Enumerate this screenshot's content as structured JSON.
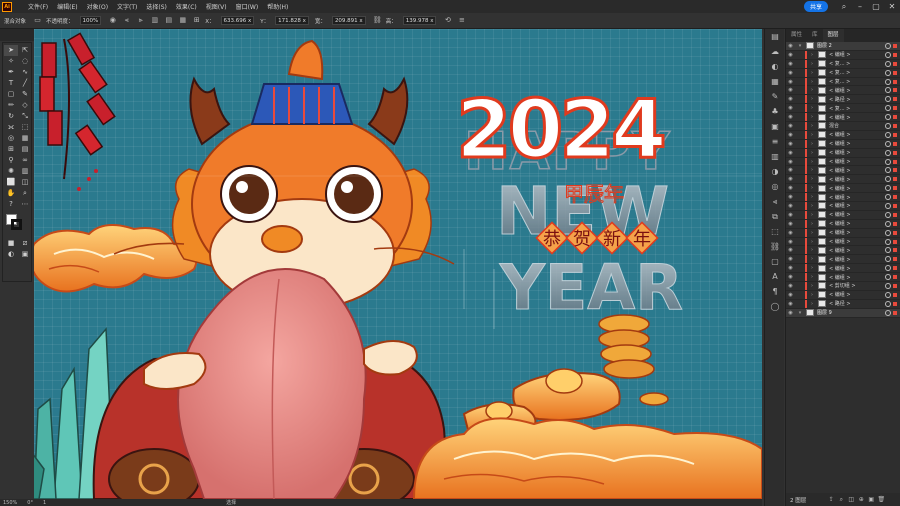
{
  "menu": {
    "logo": "Ai",
    "items": [
      "文件(F)",
      "编辑(E)",
      "对象(O)",
      "文字(T)",
      "选择(S)",
      "效果(C)",
      "视图(V)",
      "窗口(W)",
      "帮助(H)"
    ],
    "share_label": "共享"
  },
  "control": {
    "selection_label": "混合对象",
    "opacity_label": "不透明度：",
    "opacity_value": "100%",
    "x_label": "X：",
    "x_value": "633.696 x",
    "y_label": "Y：",
    "y_value": "171.828 x",
    "w_label": "宽：",
    "w_value": "209.891 x",
    "h_label": "高：",
    "h_value": "139.978 x"
  },
  "status": {
    "zoom": "150%",
    "rotation": "0°",
    "page": "1",
    "tool": "选择"
  },
  "artwork": {
    "year_text": "2024",
    "happy_text": "HAPPY",
    "new_text": "NEW",
    "year_word": "YEAR",
    "jiachen_text": "甲辰年",
    "greeting_chars": [
      "恭",
      "贺",
      "新",
      "年"
    ]
  },
  "layers_panel": {
    "tabs": [
      "属性",
      "库",
      "图层"
    ],
    "active_tab": "图层",
    "rows": [
      {
        "label": "图层 2",
        "type": "layer"
      },
      {
        "label": "< 编组 >"
      },
      {
        "label": "< 复... >"
      },
      {
        "label": "< 复... >"
      },
      {
        "label": "< 复... >"
      },
      {
        "label": "< 编组 >"
      },
      {
        "label": "< 路径 >"
      },
      {
        "label": "< 复... >"
      },
      {
        "label": "< 编组 >"
      },
      {
        "label": "混合"
      },
      {
        "label": "< 编组 >"
      },
      {
        "label": "< 编组 >"
      },
      {
        "label": "< 编组 >"
      },
      {
        "label": "< 编组 >"
      },
      {
        "label": "< 编组 >"
      },
      {
        "label": "< 编组 >"
      },
      {
        "label": "< 编组 >"
      },
      {
        "label": "< 编组 >"
      },
      {
        "label": "< 编组 >"
      },
      {
        "label": "< 编组 >"
      },
      {
        "label": "< 编组 >"
      },
      {
        "label": "< 编组 >"
      },
      {
        "label": "< 编组 >"
      },
      {
        "label": "< 编组 >"
      },
      {
        "label": "< 编组 >"
      },
      {
        "label": "< 编组 >"
      },
      {
        "label": "< 编组 >"
      },
      {
        "label": "< 剪切组 >"
      },
      {
        "label": "< 编组 >"
      },
      {
        "label": "< 路径 >"
      },
      {
        "label": "图层 9",
        "type": "layer"
      }
    ],
    "footer_label": "2 图层"
  },
  "colors": {
    "canvas_bg": "#2b7a8e",
    "accent": "#1473e6",
    "layer_color": "#e84a3c",
    "dragon_orange": "#f07b2a"
  }
}
